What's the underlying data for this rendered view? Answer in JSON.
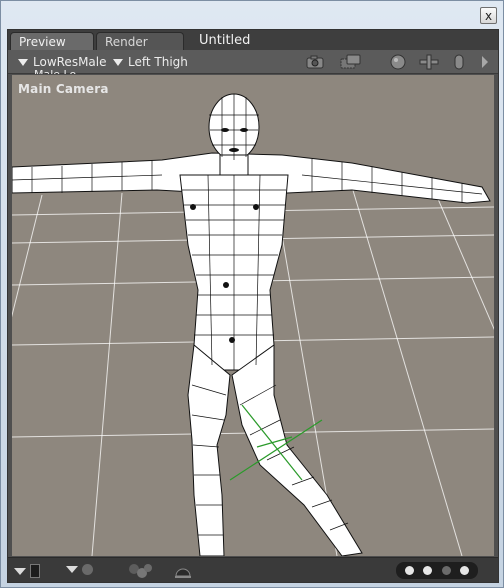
{
  "window": {
    "close_label": "x"
  },
  "tabs": [
    {
      "label": "Preview",
      "active": true
    },
    {
      "label": "Render",
      "active": false
    }
  ],
  "document_title": "Untitled",
  "toolbar": {
    "figure_dropdown": "LowResMale",
    "figure_sublabel": "Male Lo",
    "actor_dropdown": "Left Thigh",
    "icons": [
      "camera-icon",
      "camera-dolly-icon",
      "trackball-icon",
      "move-xy-icon",
      "scale-icon",
      "menu-arrow-icon"
    ]
  },
  "viewport": {
    "camera_label": "Main Camera",
    "background_color": "#8e877e",
    "grid_color": "#ffffff",
    "mesh_color": "#ffffff",
    "wire_color": "#111111",
    "manipulator_color": "#2a9a2a"
  },
  "bottombar": {
    "icons": [
      "display-style-icon",
      "render-style-icon",
      "preview-spheres-icon",
      "figure-style-icon"
    ],
    "page_dots": 4,
    "active_dots": [
      0,
      1,
      3
    ]
  }
}
